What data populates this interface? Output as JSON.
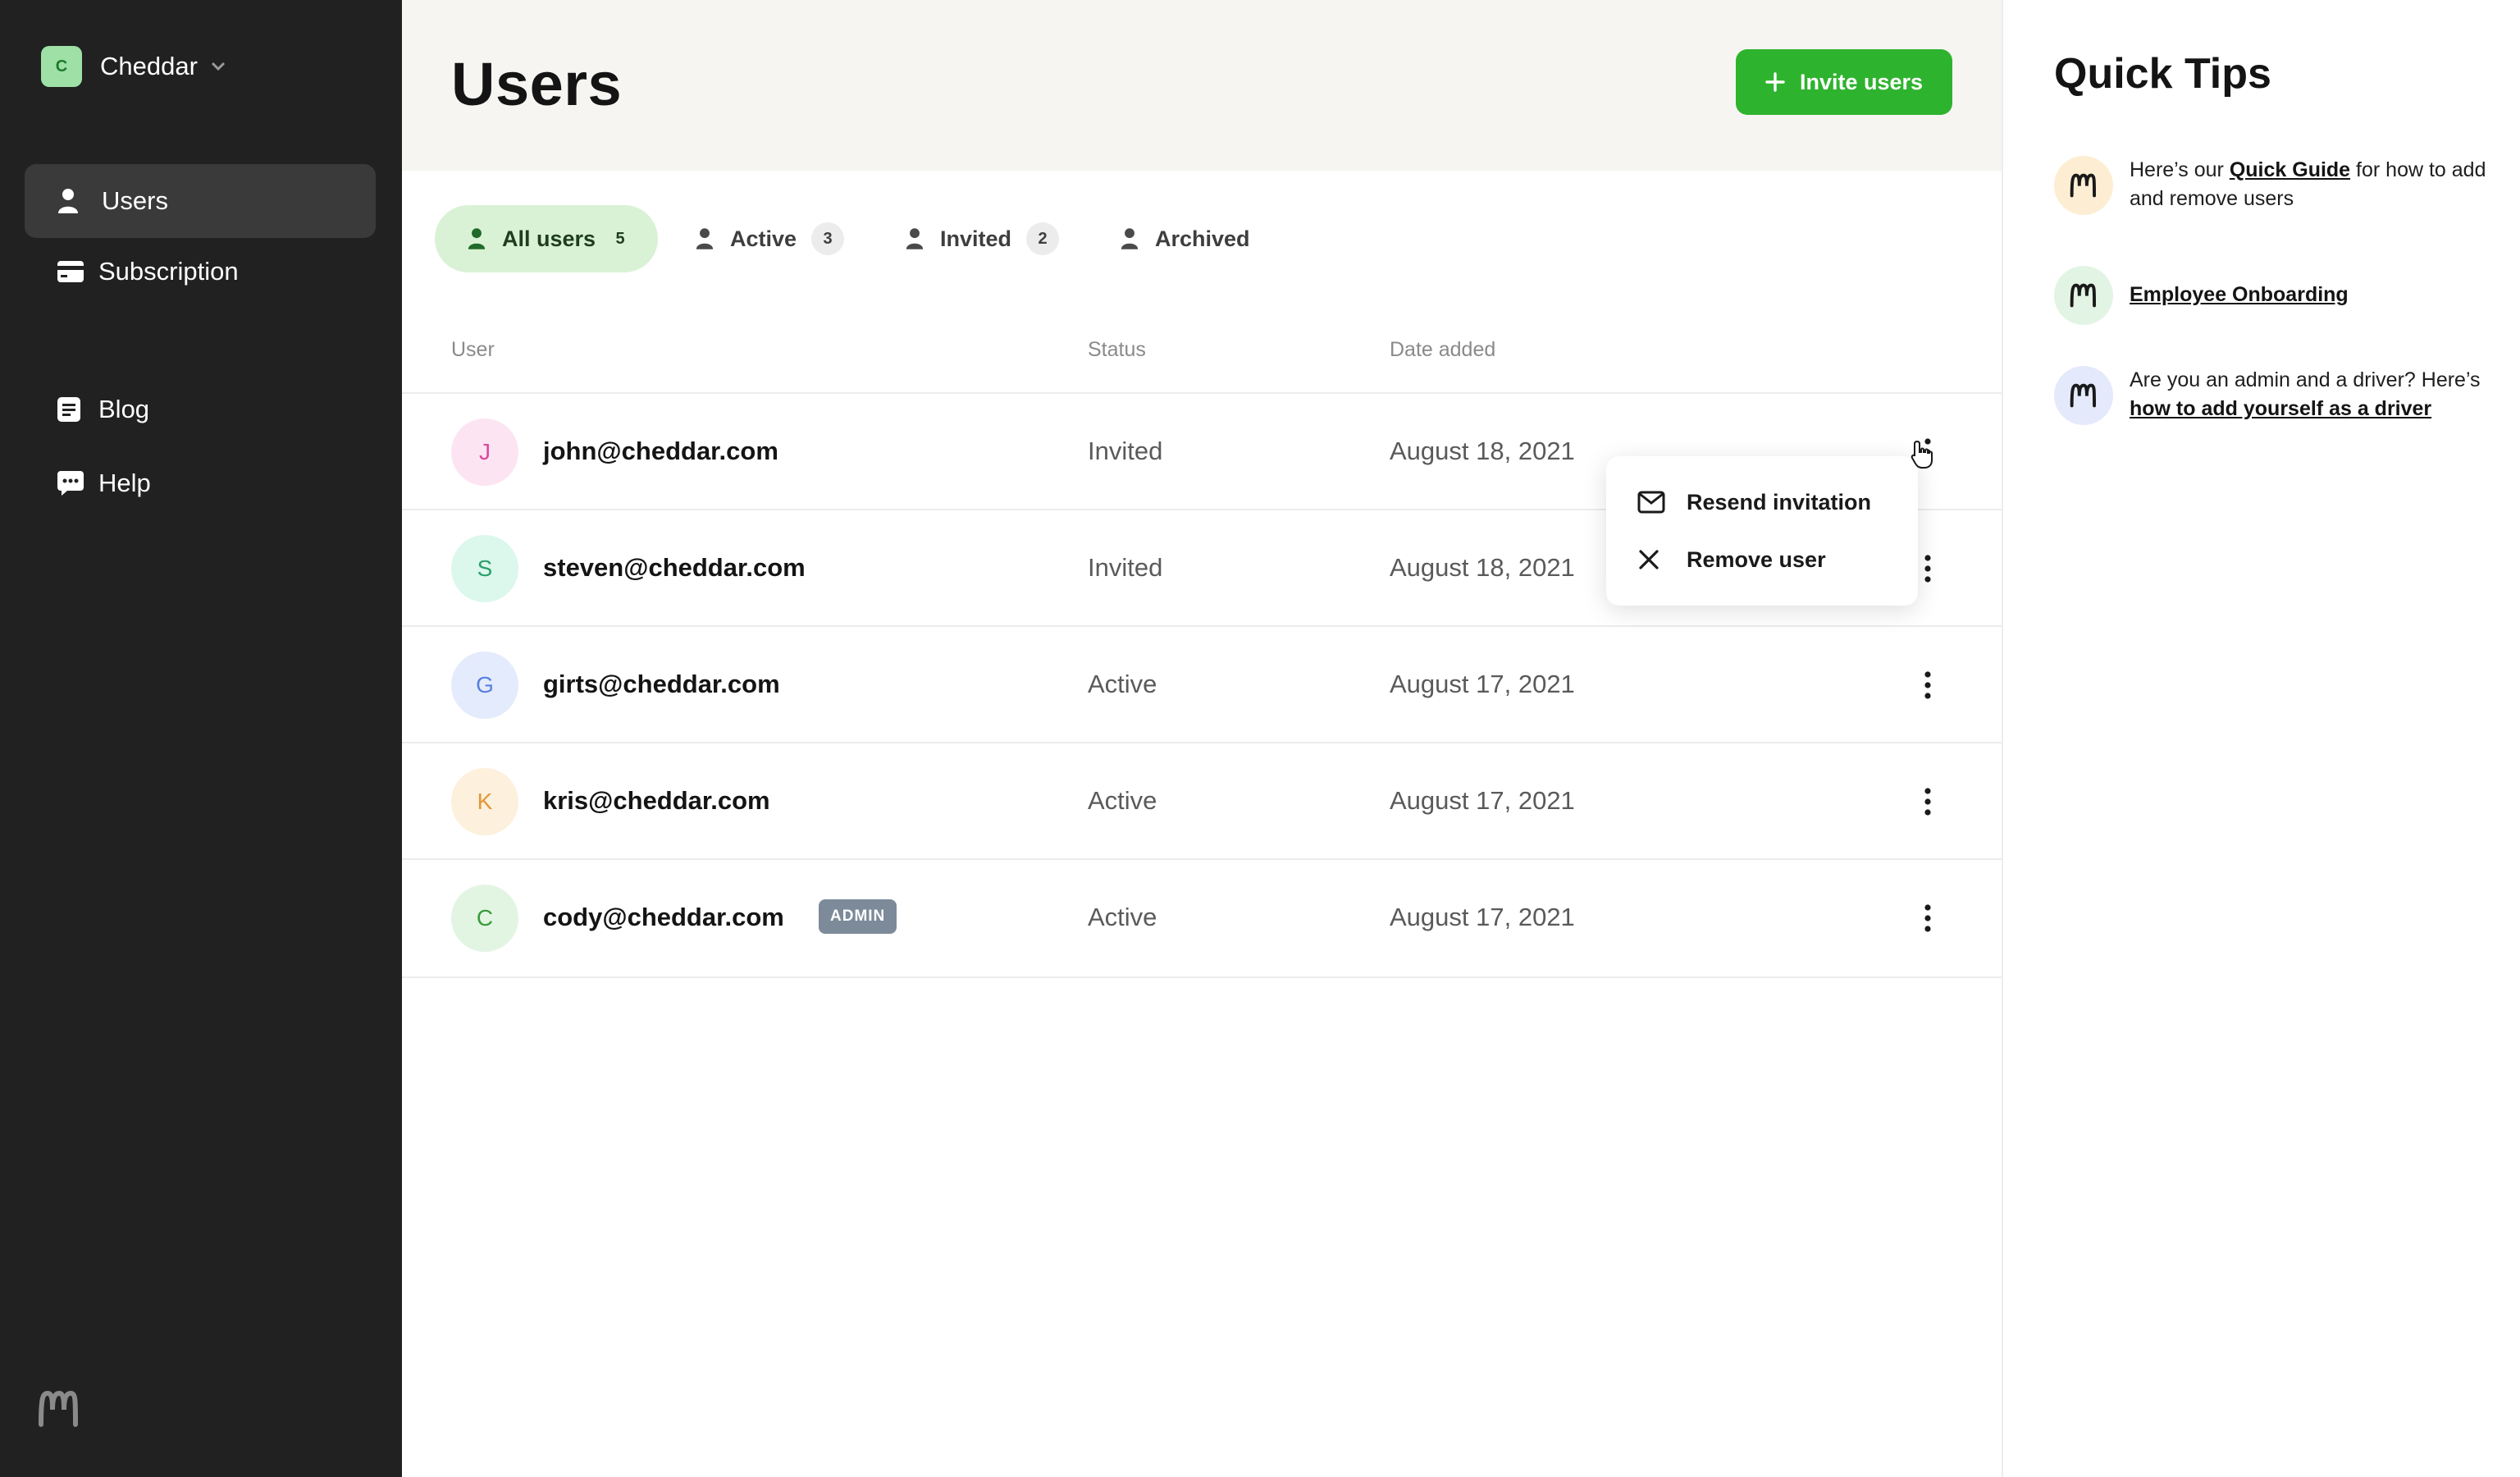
{
  "org": {
    "initial": "C",
    "name": "Cheddar"
  },
  "sidebar": {
    "items": [
      {
        "label": "Users",
        "icon": "user-icon",
        "selected": true
      },
      {
        "label": "Subscription",
        "icon": "credit-card-icon",
        "selected": false
      },
      {
        "label": "Blog",
        "icon": "blog-icon",
        "selected": false
      },
      {
        "label": "Help",
        "icon": "chat-bubble-icon",
        "selected": false
      }
    ]
  },
  "header": {
    "title": "Users",
    "invite_label": "Invite users"
  },
  "tabs": [
    {
      "label": "All users",
      "count": "5",
      "selected": true
    },
    {
      "label": "Active",
      "count": "3",
      "selected": false
    },
    {
      "label": "Invited",
      "count": "2",
      "selected": false
    },
    {
      "label": "Archived",
      "count": "",
      "selected": false
    }
  ],
  "table": {
    "columns": [
      "User",
      "Status",
      "Date added"
    ],
    "rows": [
      {
        "initial": "J",
        "email": "john@cheddar.com",
        "status": "Invited",
        "date": "August 18, 2021",
        "badge": ""
      },
      {
        "initial": "S",
        "email": "steven@cheddar.com",
        "status": "Invited",
        "date": "August 18, 2021",
        "badge": ""
      },
      {
        "initial": "G",
        "email": "girts@cheddar.com",
        "status": "Active",
        "date": "August 17, 2021",
        "badge": ""
      },
      {
        "initial": "K",
        "email": "kris@cheddar.com",
        "status": "Active",
        "date": "August 17, 2021",
        "badge": ""
      },
      {
        "initial": "C",
        "email": "cody@cheddar.com",
        "status": "Active",
        "date": "August 17, 2021",
        "badge": "ADMIN"
      }
    ]
  },
  "row_menu": {
    "items": [
      {
        "label": "Resend invitation",
        "icon": "mail-icon"
      },
      {
        "label": "Remove user",
        "icon": "close-icon"
      }
    ]
  },
  "tips": {
    "title": "Quick Tips",
    "items": [
      {
        "pre": "Here’s our ",
        "link": "Quick Guide",
        "post": " for how to add and remove users"
      },
      {
        "pre": "",
        "link": "Employee Onboarding",
        "post": ""
      },
      {
        "pre": "Are you an admin and a driver? Here’s ",
        "link": "how to add yourself as a driver",
        "post": ""
      }
    ]
  },
  "colors": {
    "sidebar_bg": "#212121",
    "accent_green": "#2eb32e",
    "selected_tab_bg": "#d9f2d5",
    "admin_badge": "#7c8a99"
  }
}
